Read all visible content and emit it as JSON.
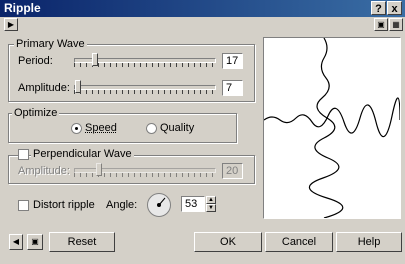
{
  "window": {
    "title": "Ripple",
    "help_label": "?",
    "close_label": "x"
  },
  "primary_wave": {
    "group_label": "Primary Wave",
    "period_label": "Period:",
    "period_value": "17",
    "amplitude_label": "Amplitude:",
    "amplitude_value": "7"
  },
  "optimize": {
    "group_label": "Optimize",
    "speed_label": "Speed",
    "quality_label": "Quality",
    "selected": "Speed"
  },
  "perpendicular_wave": {
    "checkbox_label": "Perpendicular Wave",
    "checked": false,
    "amplitude_label": "Amplitude:",
    "amplitude_value": "20"
  },
  "distort_ripple": {
    "label": "Distort ripple",
    "checked": false
  },
  "angle": {
    "label": "Angle:",
    "value": "53"
  },
  "buttons": {
    "reset": "Reset",
    "ok": "OK",
    "cancel": "Cancel",
    "help": "Help"
  }
}
